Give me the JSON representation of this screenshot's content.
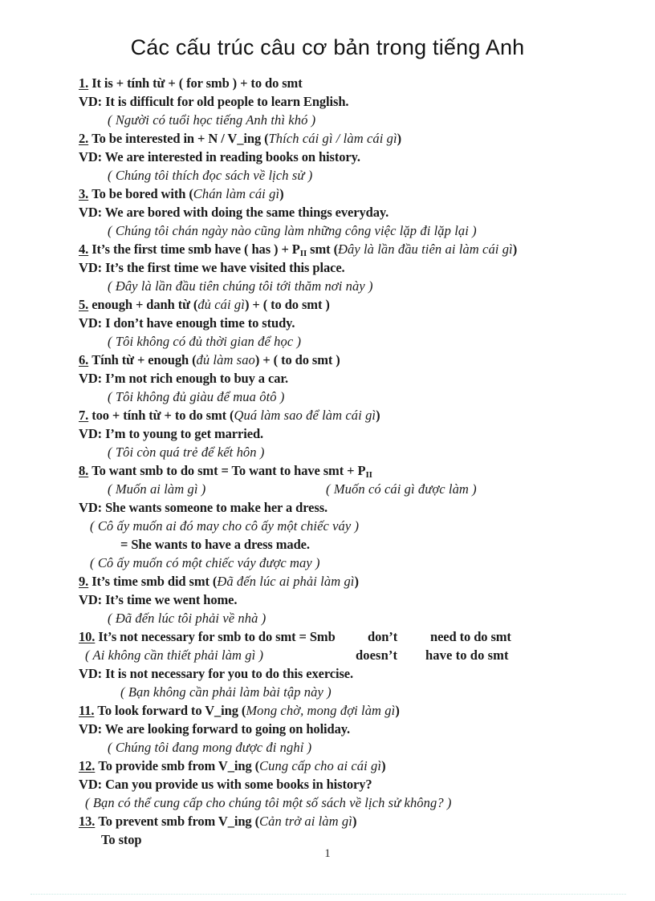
{
  "document": {
    "title": "Các cấu trúc câu cơ bản trong tiếng Anh",
    "page_number": "1"
  },
  "entries": [
    {
      "number": "1.",
      "structure": "It is + tính từ + ( for smb ) + to do smt",
      "example_label": "VD:",
      "example": "It is difficult for old people to learn English.",
      "translation": "( Người có tuổi học tiếng Anh thì khó )"
    },
    {
      "number": "2.",
      "structure": "To be interested in + N / V_ing (",
      "structure_italic": "Thích cái gì / làm cái gì",
      "structure_tail": ")",
      "example_label": "VD:",
      "example": "We are interested in reading books on history.",
      "translation": "( Chúng tôi thích đọc sách về lịch sử )"
    },
    {
      "number": "3.",
      "structure": "To be bored with  (",
      "structure_italic": "Chán làm cái gì",
      "structure_tail": ")",
      "example_label": "VD:",
      "example": "We are bored with doing the same things everyday.",
      "translation": "( Chúng tôi chán ngày nào cũng làm những công việc lặp đi lặp lại )"
    },
    {
      "number": "4.",
      "structure_pre": "It’s the first time smb have ( has ) + P",
      "structure_sub": "II",
      "structure_post": " smt  (",
      "structure_italic": "Đây là lần đầu tiên ai làm cái gì",
      "structure_tail": ")",
      "example_label": "VD:",
      "example": "It’s the first time we have visited this place.",
      "translation": "( Đây là lần đầu tiên chúng tôi tới thăm nơi này )"
    },
    {
      "number": "5.",
      "structure": "enough + danh từ (",
      "structure_italic": "đủ cái gì",
      "structure_tail": ") + ( to do smt )",
      "example_label": "VD:",
      "example": "I don’t have enough time to study.",
      "translation": "( Tôi không có đủ thời gian để học )"
    },
    {
      "number": "6.",
      "structure": "Tính từ + enough (",
      "structure_italic": "đủ làm sao",
      "structure_tail": ") + ( to do smt )",
      "example_label": "VD:",
      "example": "I’m not rich enough to buy a car.",
      "translation": "( Tôi không đủ giàu để mua ôtô )"
    },
    {
      "number": "7.",
      "structure": "too + tính từ + to do smt (",
      "structure_italic": "Quá làm sao để làm cái gì",
      "structure_tail": ")",
      "example_label": "VD:",
      "example": "I’m to young to get married.",
      "translation": "( Tôi còn quá trẻ để kết hôn )"
    },
    {
      "number": "8.",
      "structure_pre": "To want smb to do smt = To want to have smt + P",
      "structure_sub": "II",
      "sub_trans_left": "( Muốn ai làm gì )",
      "sub_trans_right": "( Muốn có cái gì được làm )",
      "example_label": "VD:",
      "example": "She wants someone to make her a dress.",
      "translation": "( Cô ấy muốn ai đó may cho cô ấy một chiếc váy )",
      "equivalent": "= She wants to have a dress made.",
      "equivalent_translation": "( Cô ấy muốn có một chiếc váy được may )"
    },
    {
      "number": "9.",
      "structure": "It’s time smb did smt (",
      "structure_italic": "Đã đến lúc ai phải làm gì",
      "structure_tail": ")",
      "example_label": "VD:",
      "example": "It’s time we went home.",
      "translation": "( Đã đến lúc tôi phải về nhà )"
    },
    {
      "number": "10.",
      "structure": "It’s not necessary for smb to do smt = Smb",
      "aux_1": "don’t",
      "aux_1_tail": "need to do smt",
      "aux_2": "doesn’t",
      "aux_2_tail": "have to do smt",
      "structure_italic_line": "( Ai không cần thiết phải làm gì )",
      "example_label": "VD:",
      "example": "It is not necessary for you to do this exercise.",
      "translation": "( Bạn không cần phải làm bài tập này )"
    },
    {
      "number": "11.",
      "structure": "To look forward to V_ing  (",
      "structure_italic": "Mong chờ, mong đợi làm gì",
      "structure_tail": ")",
      "example_label": "VD:",
      "example": "We are looking forward to going on holiday.",
      "translation": "( Chúng tôi đang mong được đi nghỉ )"
    },
    {
      "number": "12.",
      "structure": "To provide smb from V_ing (",
      "structure_italic": "Cung cấp cho ai cái gì",
      "structure_tail": ")",
      "example_label": "VD:",
      "example": "Can you provide us with  some books in history?",
      "translation": "( Bạn có thể cung cấp cho chúng tôi một số sách về lịch sử không? )"
    },
    {
      "number": "13.",
      "structure": "To prevent smb from V_ing (",
      "structure_italic": "Cản trở ai làm gì",
      "structure_tail": ")",
      "continuation": "To stop"
    }
  ]
}
